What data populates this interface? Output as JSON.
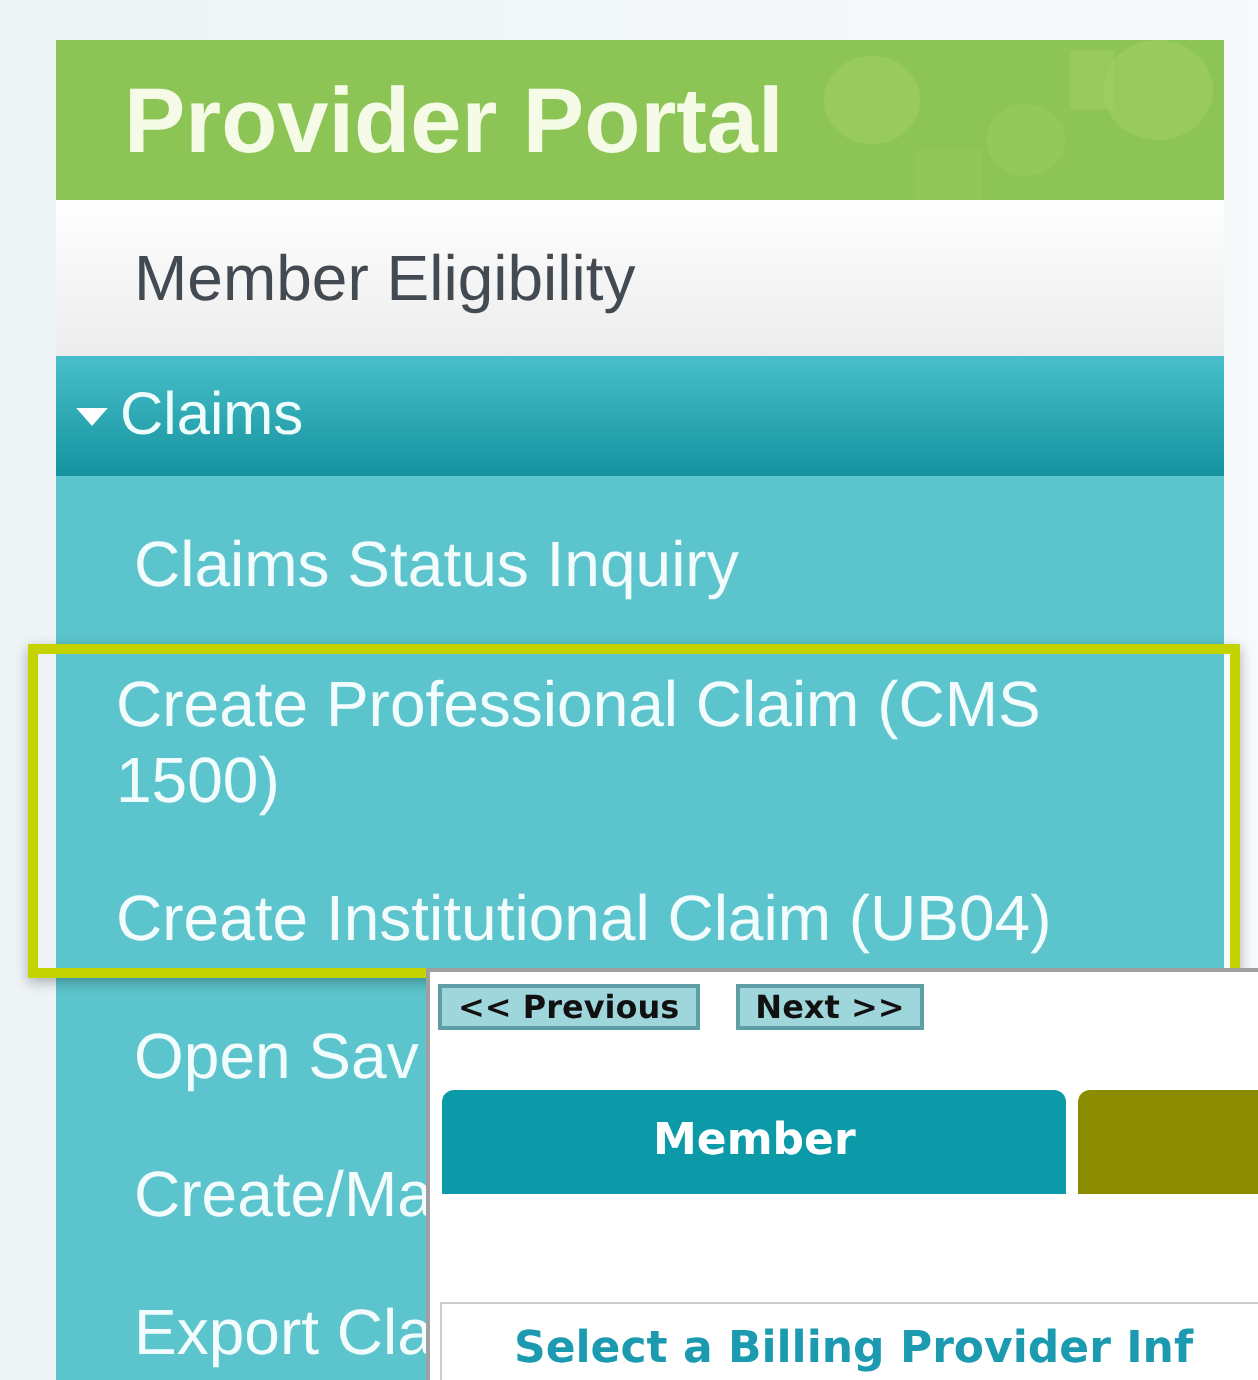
{
  "portal": {
    "title": "Provider Portal"
  },
  "menu": [
    {
      "label": "Member Eligibility",
      "kind": "link"
    },
    {
      "label": "Claims",
      "kind": "group",
      "expanded": true,
      "children": [
        {
          "label": "Claims Status Inquiry",
          "highlighted": false
        },
        {
          "label": "Create Professional Claim (CMS 1500)",
          "highlighted": true
        },
        {
          "label": "Create Institutional Claim (UB04)",
          "highlighted": true
        },
        {
          "label": "Open Sav",
          "highlighted": false
        },
        {
          "label": "Create/Ma",
          "highlighted": false
        },
        {
          "label": "Export Cla",
          "highlighted": false
        }
      ]
    }
  ],
  "claim_form": {
    "buttons": [
      "<< Previous",
      "Next >>"
    ],
    "tabs": [
      {
        "label": "Member",
        "selected": true
      },
      {
        "selected": false
      }
    ],
    "section_title": "Select a Billing Provider Inf"
  }
}
